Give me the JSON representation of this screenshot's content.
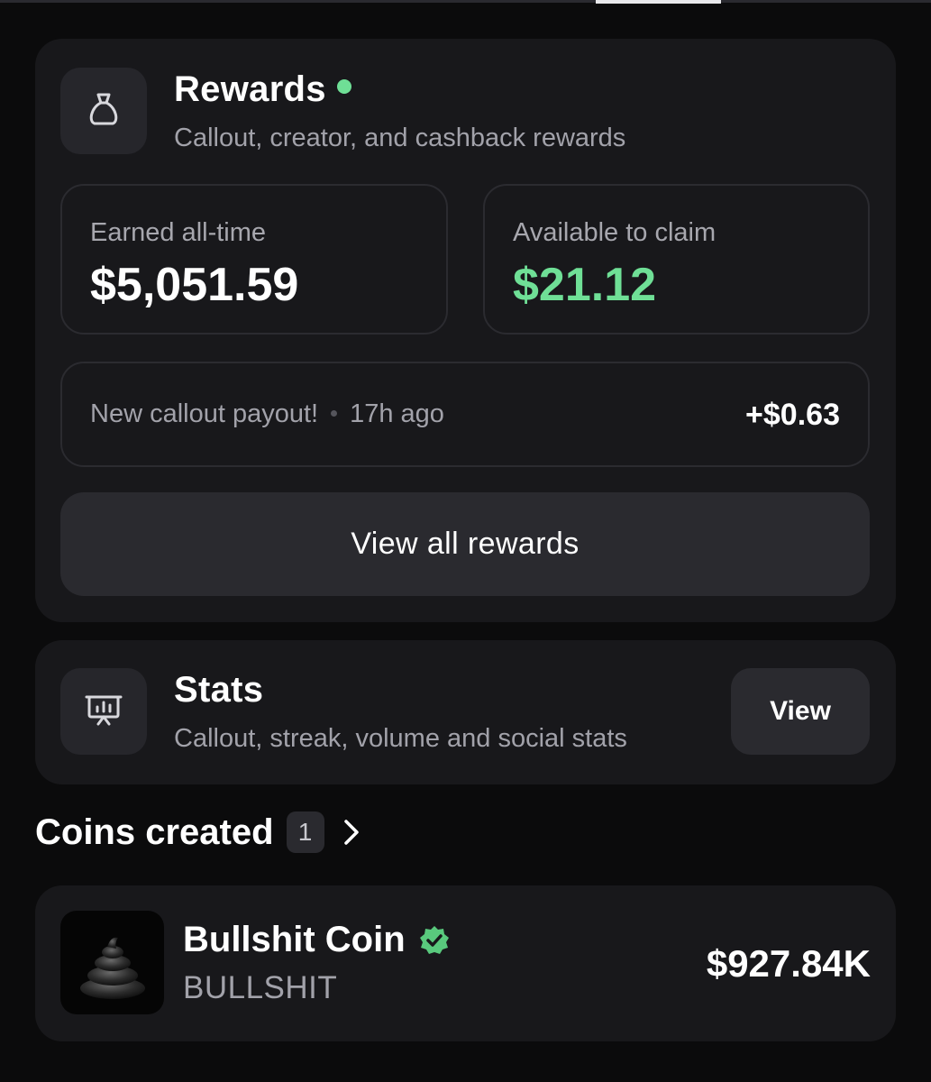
{
  "rewards": {
    "title": "Rewards",
    "subtitle": "Callout, creator, and cashback rewards",
    "earned_label": "Earned all-time",
    "earned_value": "$5,051.59",
    "available_label": "Available to claim",
    "available_value": "$21.12",
    "payout_text": "New callout payout!",
    "payout_time": "17h ago",
    "payout_amount": "+$0.63",
    "view_all_label": "View all rewards",
    "icon": "money-bag-icon"
  },
  "stats": {
    "title": "Stats",
    "subtitle": "Callout, streak, volume and social stats",
    "view_label": "View",
    "icon": "presentation-chart-icon"
  },
  "coins": {
    "section_title": "Coins created",
    "count": "1",
    "items": [
      {
        "name": "Bullshit Coin",
        "ticker": "BULLSHIT",
        "value": "$927.84K",
        "verified": true
      }
    ]
  },
  "colors": {
    "accent_green": "#6fdf96",
    "verified_green": "#59c97d",
    "background": "#0b0b0c",
    "card": "#18181b"
  }
}
